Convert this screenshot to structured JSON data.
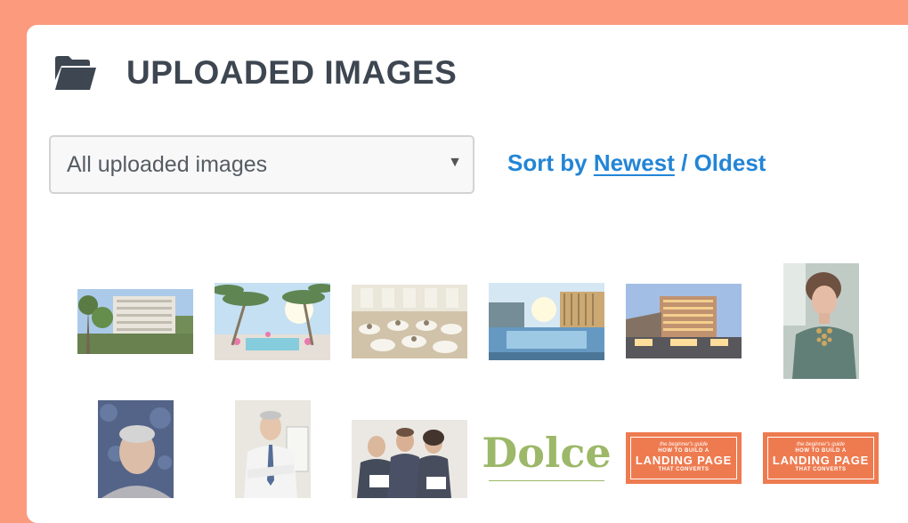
{
  "header": {
    "title": "UPLOADED IMAGES",
    "icon": "folder-icon"
  },
  "filter": {
    "selected": "All uploaded images",
    "arrow": "▼"
  },
  "sort": {
    "label": "Sort by",
    "newest": "Newest",
    "separator": "/",
    "oldest": "Oldest"
  },
  "images": {
    "dolce_logo": {
      "text": "Dolce",
      "color": "#9CB868"
    },
    "book_cover_1": {
      "tag": "the beginner's guide",
      "line1": "HOW TO BUILD A",
      "line2": "LANDING PAGE",
      "line3": "THAT CONVERTS"
    },
    "book_cover_2": {
      "tag": "the beginner's guide",
      "line1": "HOW TO BUILD A",
      "line2": "LANDING PAGE",
      "line3": "THAT CONVERTS"
    }
  },
  "colors": {
    "background": "#FB9A7D",
    "panel": "#FFFFFF",
    "title": "#3D4651",
    "link": "#2385D6",
    "book_orange": "#EE7B50"
  }
}
